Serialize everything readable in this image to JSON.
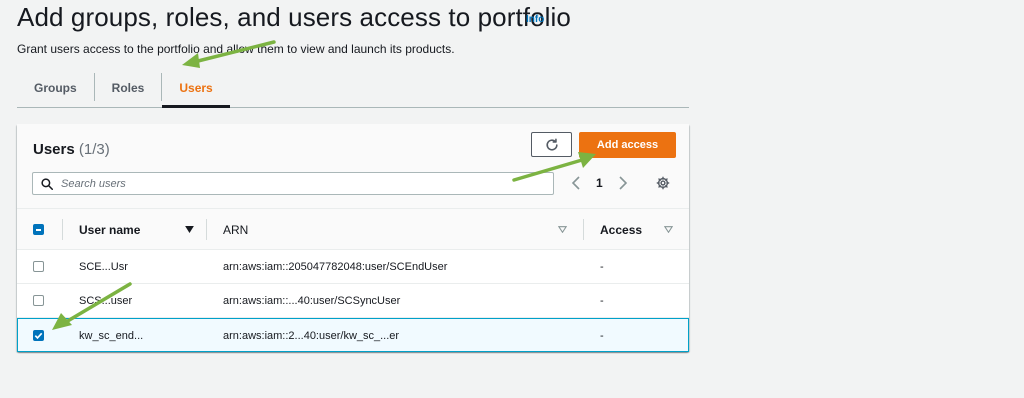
{
  "header": {
    "title": "Add groups, roles, and users access to portfolio",
    "info_label": "Info",
    "subtitle": "Grant users access to the portfolio and allow them to view and launch its products."
  },
  "tabs": [
    {
      "label": "Groups",
      "active": false
    },
    {
      "label": "Roles",
      "active": false
    },
    {
      "label": "Users",
      "active": true
    }
  ],
  "panel": {
    "title": "Users",
    "count": "(1/3)",
    "add_access_label": "Add access",
    "refresh_icon": "refresh-icon",
    "search": {
      "placeholder": "Search users",
      "value": ""
    },
    "pagination": {
      "current_page": "1"
    },
    "columns": [
      "User name",
      "ARN",
      "Access"
    ],
    "rows": [
      {
        "user_name": "SCE...Usr",
        "arn": "arn:aws:iam::205047782048:user/SCEndUser",
        "access": "-",
        "selected": false
      },
      {
        "user_name": "SCS...user",
        "arn": "arn:aws:iam::...40:user/SCSyncUser",
        "access": "-",
        "selected": false
      },
      {
        "user_name": "kw_sc_end...",
        "arn": "arn:aws:iam::2...40:user/kw_sc_...er",
        "access": "-",
        "selected": true
      }
    ]
  },
  "colors": {
    "accent": "#ec7211",
    "link": "#0073bb",
    "annotation_arrow": "#7cb342",
    "selected_row_bg": "#f1faff",
    "selected_row_border": "#00a1c9"
  }
}
